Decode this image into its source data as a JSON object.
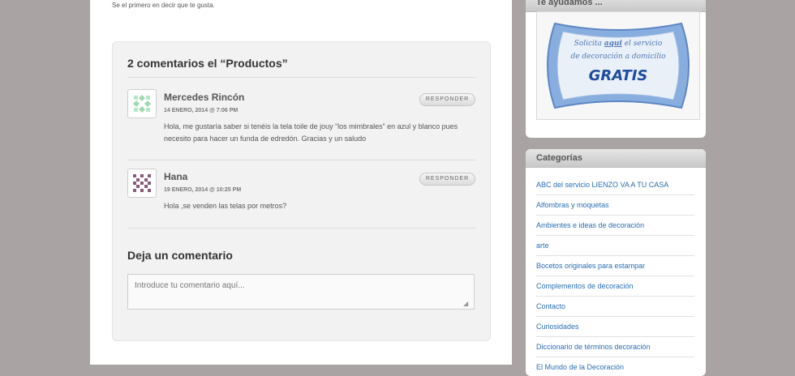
{
  "likes": {
    "text": "Se el primero en decir que te gusta."
  },
  "comments": {
    "title": "2 comentarios el “Productos”",
    "items": [
      {
        "author": "Mercedes Rincón",
        "date": "14 ENERO, 2014 @ 7:06 PM",
        "text": "Hola, me gustaría saber si tenéis la tela toile de jouy “los mimbrales” en azul y blanco pues necesito para hacer un funda de edredón. Gracias y un saludo",
        "reply_label": "RESPONDER"
      },
      {
        "author": "Hana",
        "date": "19 ENERO, 2014 @ 10:25 PM",
        "text": "Hola ,se venden las telas por metros?",
        "reply_label": "RESPONDER"
      }
    ]
  },
  "leave_comment": {
    "title": "Deja un comentario",
    "placeholder": "Introduce tu comentario aquí..."
  },
  "sidebar": {
    "help_widget": {
      "title": "Te ayudamos ...",
      "promo_line1_pre": "Solicita ",
      "promo_line1_link": "aqui",
      "promo_line1_post": " el servicio",
      "promo_line2": "de decoración a domicilio",
      "promo_gratis": "GRATIS"
    },
    "categories": {
      "title": "Categorías",
      "items": [
        "ABC del servicio LIENZO VA A TU CASA",
        "Alfombras y moquetas",
        "Ambientes e ideas de decoración",
        "arte",
        "Bocetos originales para estampar",
        "Complementos de decoración",
        "Contacto",
        "Curiosidades",
        "Diccionario de términos decoración",
        "El Mundo de la Decoración"
      ]
    }
  },
  "colors": {
    "link": "#2a6db3",
    "background": "#aaa3a3",
    "promo_blue": "#7fa6d9"
  }
}
